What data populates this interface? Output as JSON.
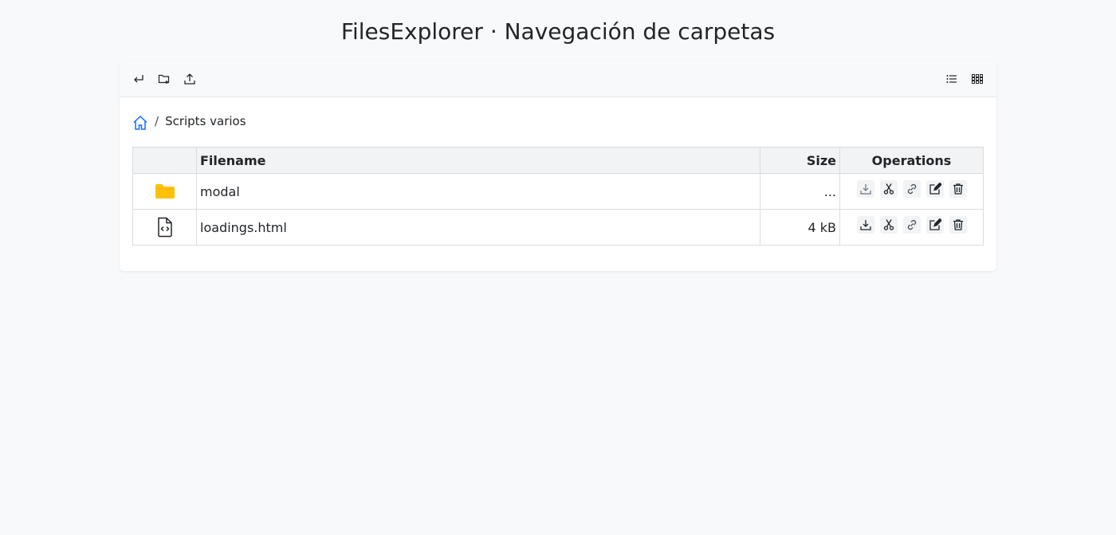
{
  "page": {
    "title": "FilesExplorer · Navegación de carpetas"
  },
  "toolbar": {
    "left_icons": [
      "return-icon",
      "new-folder-icon",
      "upload-icon"
    ],
    "right_icons": [
      "list-view-icon",
      "grid-view-icon"
    ]
  },
  "breadcrumb": {
    "home_icon": "home-icon",
    "separator": "/",
    "current": "Scripts varios"
  },
  "table": {
    "headers": {
      "icon": "",
      "filename": "Filename",
      "size": "Size",
      "operations": "Operations"
    },
    "rows": [
      {
        "icon": "folder-icon",
        "name": "modal",
        "size": "..."
      },
      {
        "icon": "html-file-icon",
        "name": "loadings.html",
        "size": "4 kB"
      }
    ],
    "operations": [
      "download-icon",
      "cut-icon",
      "link-icon",
      "edit-icon",
      "delete-icon"
    ]
  },
  "colors": {
    "background": "#f8f9fa",
    "folder": "#ffc107",
    "home": "#0d6efd"
  }
}
